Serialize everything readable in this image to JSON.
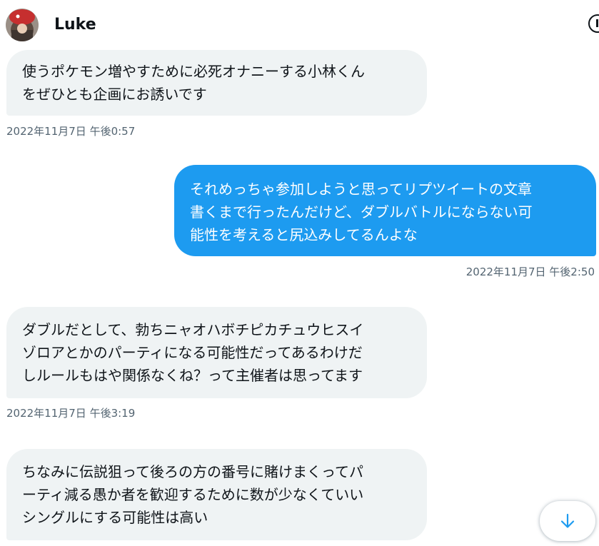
{
  "header": {
    "username": "Luke",
    "avatar_icon": "user-avatar",
    "info_icon": "info-icon"
  },
  "messages": [
    {
      "direction": "incoming",
      "text": "使うポケモン増やすために必死オナニーする小林くん\nをぜひとも企画にお誘いです",
      "timestamp": "2022年11月7日 午後0:57"
    },
    {
      "direction": "outgoing",
      "text": "それめっちゃ参加しようと思ってリプツイートの文章\n書くまで行ったんだけど、ダブルバトルにならない可\n能性を考えると尻込みしてるんよな",
      "timestamp": "2022年11月7日 午後2:50"
    },
    {
      "direction": "incoming",
      "text": "ダブルだとして、勃ちニャオハボチピカチュウヒスイ\nゾロアとかのパーティになる可能性だってあるわけだ\nしルールもはや関係なくね？って主催者は思ってます",
      "timestamp": "2022年11月7日 午後3:19"
    },
    {
      "direction": "incoming",
      "text": "ちなみに伝説狙って後ろの方の番号に賭けまくってパ\nーティ減る愚か者を歓迎するために数が少なくていい\nシングルにする可能性は高い",
      "timestamp": ""
    }
  ],
  "scroll_button": {
    "icon": "arrow-down-icon"
  },
  "colors": {
    "outgoing_bubble": "#1d9bf0",
    "incoming_bubble": "#eff3f4",
    "timestamp": "#536471",
    "text": "#0f1419"
  }
}
